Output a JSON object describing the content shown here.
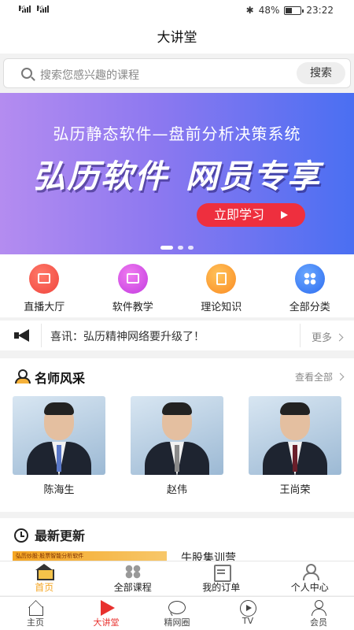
{
  "status_bar": {
    "net1_tag": "4G",
    "net2_tag": "3G",
    "battery_text": "48%",
    "battery_level": 0.48,
    "time": "23:22",
    "bluetooth_icon": "bluetooth-icon"
  },
  "header": {
    "title": "大讲堂"
  },
  "search": {
    "placeholder": "搜索您感兴趣的课程",
    "button_label": "搜索"
  },
  "banner": {
    "subtitle": "弘历静态软件—盘前分析决策系统",
    "headline_left": "弘历软件",
    "headline_right": "网员专享",
    "cta_label": "立即学习",
    "active_slide": 1,
    "slide_count": 3
  },
  "categories": [
    {
      "label": "直播大厅",
      "icon": "live-icon",
      "color": "#f0443c"
    },
    {
      "label": "软件教学",
      "icon": "software-icon",
      "color": "#c23ae0"
    },
    {
      "label": "理论知识",
      "icon": "book-icon",
      "color": "#fa8a22"
    },
    {
      "label": "全部分类",
      "icon": "grid-icon",
      "color": "#2d6cf0"
    }
  ],
  "news": {
    "text": "喜讯：弘历精神网络要升级了！",
    "more_label": "更多"
  },
  "teachers_section": {
    "title": "名师风采",
    "view_all_label": "查看全部",
    "teachers": [
      {
        "name": "陈海生"
      },
      {
        "name": "赵伟"
      },
      {
        "name": "王尚荣"
      }
    ]
  },
  "latest_section": {
    "title": "最新更新",
    "thumb_text": "弘历炒股·股票智能分析软件",
    "course_title": "牛股集训营"
  },
  "inner_nav": [
    {
      "label": "首页",
      "icon": "home-icon"
    },
    {
      "label": "全部课程",
      "icon": "courses-icon"
    },
    {
      "label": "我的订单",
      "icon": "orders-icon"
    },
    {
      "label": "个人中心",
      "icon": "user-icon"
    }
  ],
  "tab_bar": [
    {
      "label": "主页",
      "icon": "home-icon"
    },
    {
      "label": "大讲堂",
      "icon": "play-icon"
    },
    {
      "label": "精网圈",
      "icon": "chat-icon"
    },
    {
      "label": "TV",
      "icon": "tv-icon"
    },
    {
      "label": "会员",
      "icon": "member-icon"
    }
  ],
  "colors": {
    "accent_red": "#e8312e",
    "accent_orange": "#f5a623",
    "banner_start": "#b48cf0",
    "banner_end": "#4a6ff2"
  }
}
